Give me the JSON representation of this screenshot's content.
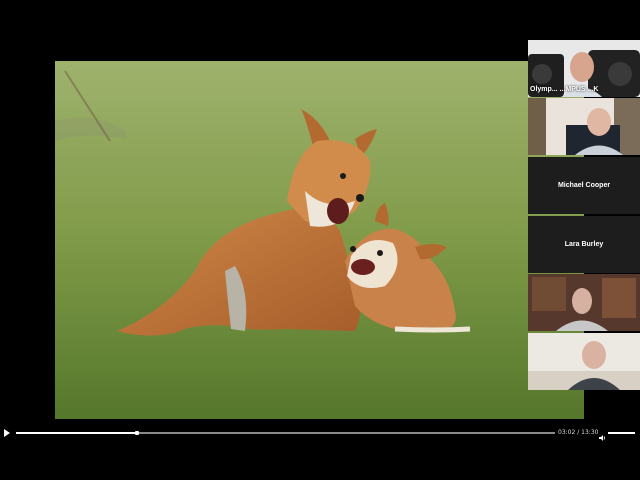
{
  "participants": [
    {
      "name": "",
      "overlay": "Olymp... ...MPUS ...K"
    },
    {
      "name": "",
      "overlay": ""
    },
    {
      "name": "Michael Cooper",
      "overlay": ""
    },
    {
      "name": "Lara Burley",
      "overlay": ""
    },
    {
      "name": "",
      "overlay": ""
    },
    {
      "name": "",
      "overlay": ""
    }
  ],
  "player": {
    "current_time": "03:02",
    "duration": "13:30",
    "progress": 0.225,
    "volume": 1.0
  },
  "shared_content": {
    "subject": "two fox cubs playing on grass"
  },
  "icons": [
    "play-icon",
    "volume-icon"
  ]
}
